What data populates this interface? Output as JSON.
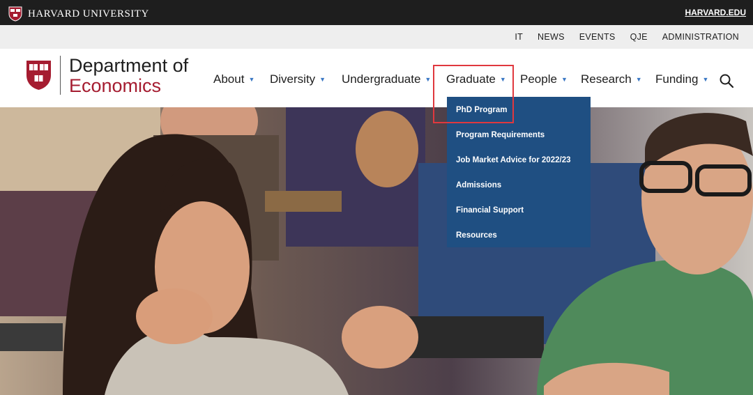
{
  "topbar": {
    "university": "HARVARD UNIVERSITY",
    "link": "HARVARD.EDU"
  },
  "utility_nav": {
    "items": [
      "IT",
      "NEWS",
      "EVENTS",
      "QJE",
      "ADMINISTRATION"
    ]
  },
  "header": {
    "title_line1": "Department of",
    "title_line2": "Economics"
  },
  "main_nav": {
    "items": [
      {
        "label": "About",
        "caret": "▼"
      },
      {
        "label": "Diversity",
        "caret": "▼"
      },
      {
        "label": "Undergraduate",
        "caret": "▼"
      },
      {
        "label": "Graduate",
        "caret": "▼"
      },
      {
        "label": "People",
        "caret": "▼"
      },
      {
        "label": "Research",
        "caret": "▼"
      },
      {
        "label": "Funding",
        "caret": "▼"
      }
    ],
    "search_icon": "search-icon"
  },
  "dropdown": {
    "parent": "Graduate",
    "items": [
      "PhD Program",
      "Program Requirements",
      "Job Market Advice for 2022/23",
      "Admissions",
      "Financial Support",
      "Resources"
    ]
  },
  "colors": {
    "crimson": "#a51c30",
    "dropdown_bg": "#1f4f82",
    "caret_blue": "#3a77c4",
    "highlight_red": "#e0383e",
    "topbar_bg": "#1e1e1e"
  }
}
